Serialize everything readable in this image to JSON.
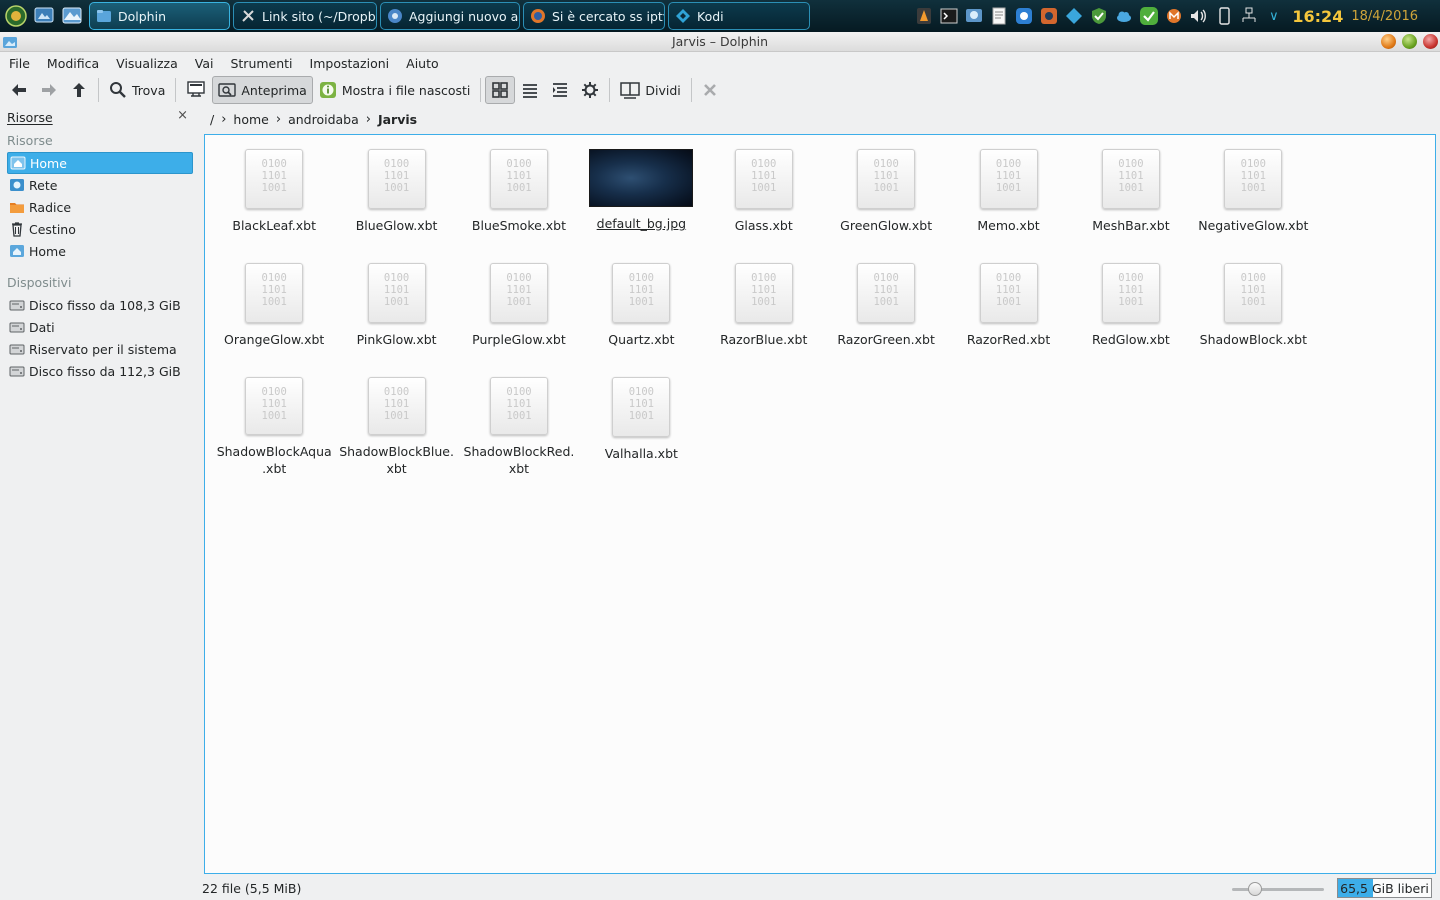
{
  "taskbar": {
    "tasks": [
      {
        "label": "Dolphin",
        "active": true
      },
      {
        "label": "Link sito (~/Dropb",
        "active": false
      },
      {
        "label": "Aggiungi nuovo ar",
        "active": false
      },
      {
        "label": "Si è cercato ss iptv",
        "active": false
      },
      {
        "label": "Kodi",
        "active": false
      }
    ],
    "clock": "16:24",
    "date": "18/4/2016"
  },
  "window": {
    "title": "Jarvis – Dolphin"
  },
  "menu": [
    "File",
    "Modifica",
    "Visualizza",
    "Vai",
    "Strumenti",
    "Impostazioni",
    "Aiuto"
  ],
  "toolbar": {
    "find": "Trova",
    "preview": "Anteprima",
    "show_hidden": "Mostra i file nascosti",
    "split": "Dividi"
  },
  "sidebar": {
    "title": "Risorse",
    "close": "×",
    "places_label": "Risorse",
    "places": [
      {
        "label": "Home",
        "icon": "home-icon",
        "selected": true
      },
      {
        "label": "Rete",
        "icon": "network-icon",
        "selected": false
      },
      {
        "label": "Radice",
        "icon": "folder-icon",
        "selected": false
      },
      {
        "label": "Cestino",
        "icon": "trash-icon",
        "selected": false
      },
      {
        "label": "Home",
        "icon": "home-icon",
        "selected": false
      }
    ],
    "devices_label": "Dispositivi",
    "devices": [
      {
        "label": "Disco fisso da 108,3 GiB"
      },
      {
        "label": "Dati"
      },
      {
        "label": "Riservato per il sistema"
      },
      {
        "label": "Disco fisso da 112,3 GiB"
      }
    ]
  },
  "breadcrumb": [
    "/",
    "home",
    "androidaba",
    "Jarvis"
  ],
  "files": [
    {
      "name": "BlackLeaf.xbt",
      "kind": "binary"
    },
    {
      "name": "BlueGlow.xbt",
      "kind": "binary"
    },
    {
      "name": "BlueSmoke.xbt",
      "kind": "binary"
    },
    {
      "name": "default_bg.jpg",
      "kind": "image"
    },
    {
      "name": "Glass.xbt",
      "kind": "binary"
    },
    {
      "name": "GreenGlow.xbt",
      "kind": "binary"
    },
    {
      "name": "Memo.xbt",
      "kind": "binary"
    },
    {
      "name": "MeshBar.xbt",
      "kind": "binary"
    },
    {
      "name": "NegativeGlow.xbt",
      "kind": "binary"
    },
    {
      "name": "OrangeGlow.xbt",
      "kind": "binary"
    },
    {
      "name": "PinkGlow.xbt",
      "kind": "binary"
    },
    {
      "name": "PurpleGlow.xbt",
      "kind": "binary"
    },
    {
      "name": "Quartz.xbt",
      "kind": "binary"
    },
    {
      "name": "RazorBlue.xbt",
      "kind": "binary"
    },
    {
      "name": "RazorGreen.xbt",
      "kind": "binary"
    },
    {
      "name": "RazorRed.xbt",
      "kind": "binary"
    },
    {
      "name": "RedGlow.xbt",
      "kind": "binary"
    },
    {
      "name": "ShadowBlock.xbt",
      "kind": "binary"
    },
    {
      "name": "ShadowBlockAqua.xbt",
      "kind": "binary"
    },
    {
      "name": "ShadowBlockBlue.xbt",
      "kind": "binary"
    },
    {
      "name": "ShadowBlockRed.xbt",
      "kind": "binary"
    },
    {
      "name": "Valhalla.xbt",
      "kind": "binary"
    }
  ],
  "binary_icon_text": "0100\n1101\n1001",
  "status": {
    "summary": "22 file (5,5 MiB)",
    "zoom_fraction": 0.25,
    "free_space_number": "65,5",
    "free_space_unit": "GiB liberi",
    "used_fraction": 0.38
  },
  "colors": {
    "accent": "#3daee9",
    "clock": "#f4c63c"
  }
}
